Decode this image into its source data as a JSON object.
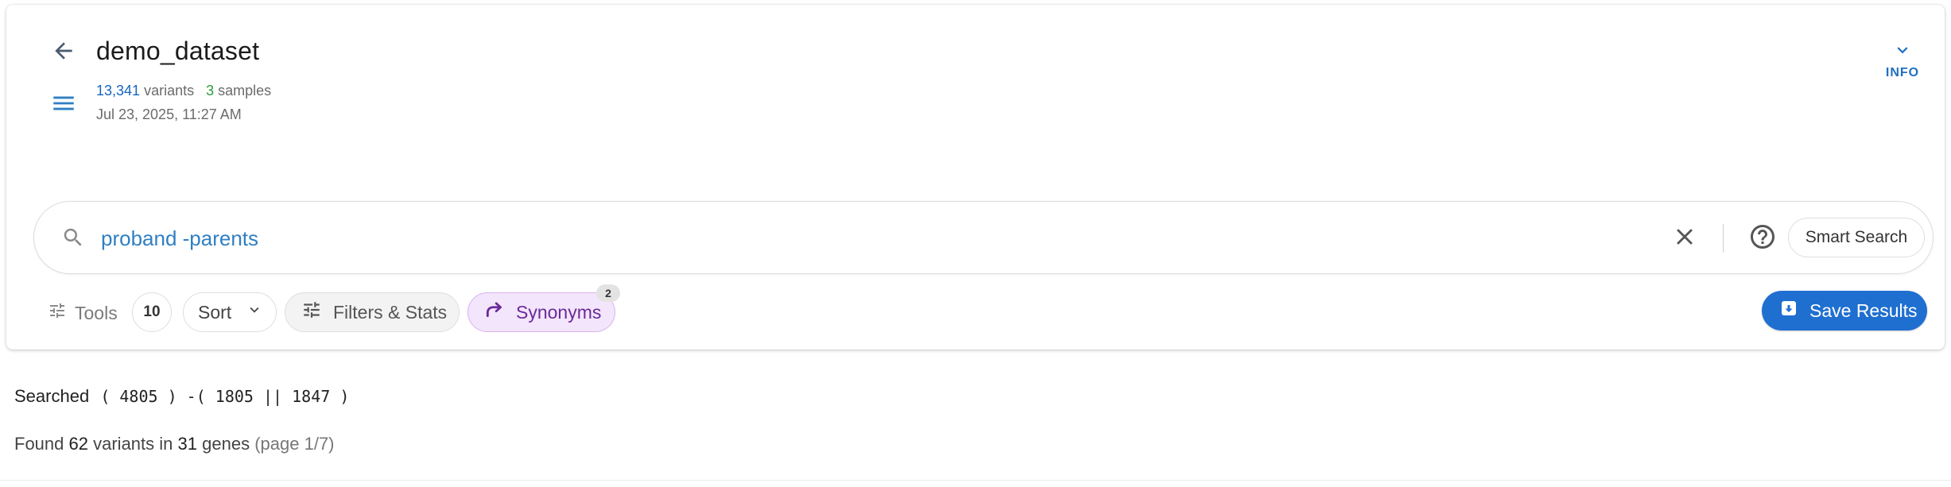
{
  "header": {
    "title": "demo_dataset",
    "variants_count": "13,341",
    "variants_label": "variants",
    "samples_count": "3",
    "samples_label": "samples",
    "date": "Jul 23, 2025, 11:27 AM",
    "info_label": "INFO",
    "icons": {
      "back": "arrow-left-icon",
      "menu": "hamburger-menu-icon",
      "info": "chevron-down-icon"
    }
  },
  "search": {
    "value": "proband -parents",
    "smart_search_label": "Smart Search",
    "icons": {
      "search": "search-icon",
      "clear": "close-icon",
      "help": "help-circle-icon"
    }
  },
  "toolbar": {
    "tools_label": "Tools",
    "count": "10",
    "sort_label": "Sort",
    "filters_label": "Filters & Stats",
    "synonyms_label": "Synonyms",
    "synonyms_badge": "2",
    "save_label": "Save Results"
  },
  "results": {
    "searched_label": "Searched",
    "searched_query": "( 4805 ) -( 1805 || 1847 )",
    "found_prefix": "Found",
    "found_variants": "62",
    "found_variants_label": "variants in",
    "found_genes": "31",
    "found_genes_label": "genes",
    "found_page": "(page 1/7)"
  },
  "colors": {
    "accent_blue": "#1f6fd1",
    "variants_blue": "#1565c0",
    "samples_green": "#2e9d3a",
    "synonyms_purple": "#6a2a99",
    "synonyms_bg": "#f3e5fb"
  }
}
